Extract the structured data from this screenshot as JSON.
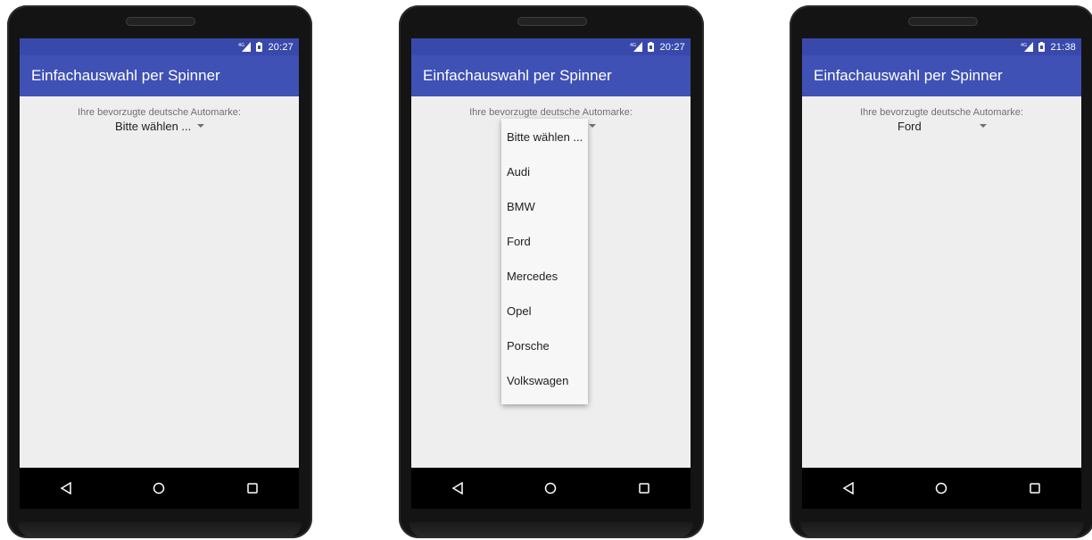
{
  "phones": [
    {
      "status": {
        "time": "20:27",
        "network": "4G"
      },
      "app_title": "Einfachauswahl per Spinner",
      "prompt": "Ihre bevorzugte deutsche Automarke:",
      "spinner_value": "Bitte wählen ..."
    },
    {
      "status": {
        "time": "20:27",
        "network": "4G"
      },
      "app_title": "Einfachauswahl per Spinner",
      "prompt": "Ihre bevorzugte deutsche Automarke:",
      "spinner_value": "Bitte wählen ...",
      "dropdown_open": true,
      "options": [
        "Bitte wählen ...",
        "Audi",
        "BMW",
        "Ford",
        "Mercedes",
        "Opel",
        "Porsche",
        "Volkswagen"
      ]
    },
    {
      "status": {
        "time": "21:38",
        "network": "4G"
      },
      "app_title": "Einfachauswahl per Spinner",
      "prompt": "Ihre bevorzugte deutsche Automarke:",
      "spinner_value": "Ford"
    }
  ],
  "icons": {
    "signal": "signal-icon",
    "battery": "battery-icon",
    "back": "back-icon",
    "home": "home-icon",
    "recents": "recents-icon",
    "dropdown_arrow": "dropdown-arrow-icon"
  },
  "colors": {
    "status_bar": "#3949ab",
    "app_bar": "#3f51b5",
    "screen_background": "#eeeeee",
    "phone_body": "#141414"
  }
}
